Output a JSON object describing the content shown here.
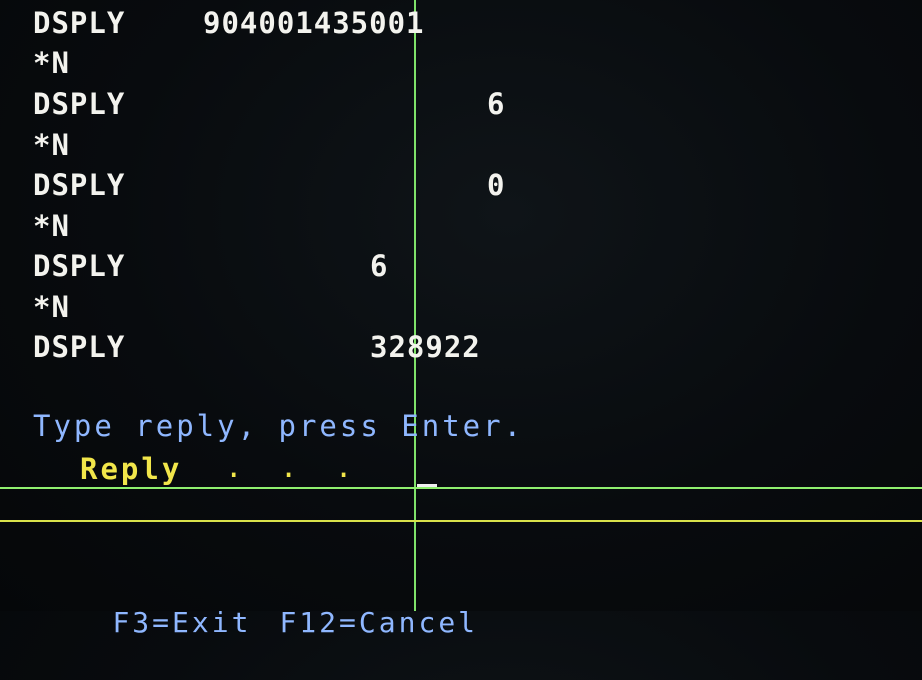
{
  "messages": [
    {
      "label": "DSPLY",
      "value": "904001435001"
    },
    {
      "label": "*N"
    },
    {
      "label": "DSPLY",
      "value": "6"
    },
    {
      "label": "*N"
    },
    {
      "label": "DSPLY",
      "value": "0"
    },
    {
      "label": "*N"
    },
    {
      "label": "DSPLY",
      "value": "6"
    },
    {
      "label": "*N"
    },
    {
      "label": "DSPLY",
      "value": "328922"
    }
  ],
  "prompt": {
    "text": "Type reply, press Enter."
  },
  "reply": {
    "label": "Reply",
    "dots": ". . .",
    "value": ""
  },
  "function_keys": [
    {
      "label": "F3=Exit"
    },
    {
      "label": "F12=Cancel"
    }
  ],
  "colors": {
    "message_text": "#f3f3ee",
    "prompt_text": "#8fb7ff",
    "reply_label": "#f1e64a",
    "rule_green": "#8ff06f",
    "rule_yellow": "#d9e24b"
  }
}
